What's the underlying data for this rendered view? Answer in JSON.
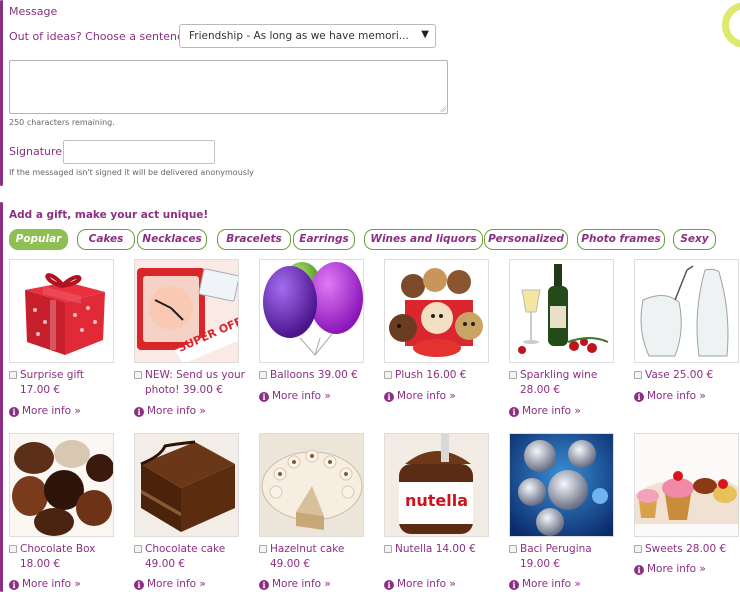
{
  "message_section": {
    "title": "Message",
    "ideas_label": "Out of ideas? Choose a sentence!",
    "sentence_selected": "Friendship - As long as we have memori...",
    "message_value": "",
    "chars_remaining": "250 characters remaining.",
    "signature_label": "Signature",
    "signature_value": "",
    "anonymous_note": "If the messaged isn't signed it will be delivered anonymously"
  },
  "gift_section": {
    "title": "Add a gift, make your act unique!",
    "tabs": [
      "Popular",
      "Cakes",
      "Necklaces",
      "Bracelets",
      "Earrings",
      "Wines and liquors",
      "Personalized",
      "Photo frames",
      "Sexy"
    ],
    "active_tab": "Popular",
    "more_info": "More info »",
    "products": [
      {
        "name": "Surprise gift",
        "price": "17.00 €",
        "image": "gift-box"
      },
      {
        "name": "NEW: Send us your photo! 39.00 €",
        "price": "",
        "image": "photo-clock"
      },
      {
        "name": "Balloons 39.00 €",
        "price": "",
        "image": "balloons"
      },
      {
        "name": "Plush 16.00 €",
        "price": "",
        "image": "teddy-bears"
      },
      {
        "name": "Sparkling wine",
        "price": "28.00 €",
        "image": "sparkling-wine"
      },
      {
        "name": "Vase 25.00 €",
        "price": "",
        "image": "glass-vases"
      },
      {
        "name": "Chocolate Box",
        "price": "18.00 €",
        "image": "chocolates"
      },
      {
        "name": "Chocolate cake",
        "price": "49.00 €",
        "image": "chocolate-cake"
      },
      {
        "name": "Hazelnut cake",
        "price": "49.00 €",
        "image": "hazelnut-cake"
      },
      {
        "name": "Nutella 14.00 €",
        "price": "",
        "image": "nutella-jar"
      },
      {
        "name": "Baci Perugina",
        "price": "19.00 €",
        "image": "baci-chocolates"
      },
      {
        "name": "Sweets 28.00 €",
        "price": "",
        "image": "sweets"
      }
    ],
    "photo_badge": "SUPER OFFERTA",
    "nutella_label": "nutella"
  },
  "colors": {
    "accent": "#8b2f83",
    "tab_active": "#8dbf53",
    "tab_border": "#6a9f3a"
  }
}
